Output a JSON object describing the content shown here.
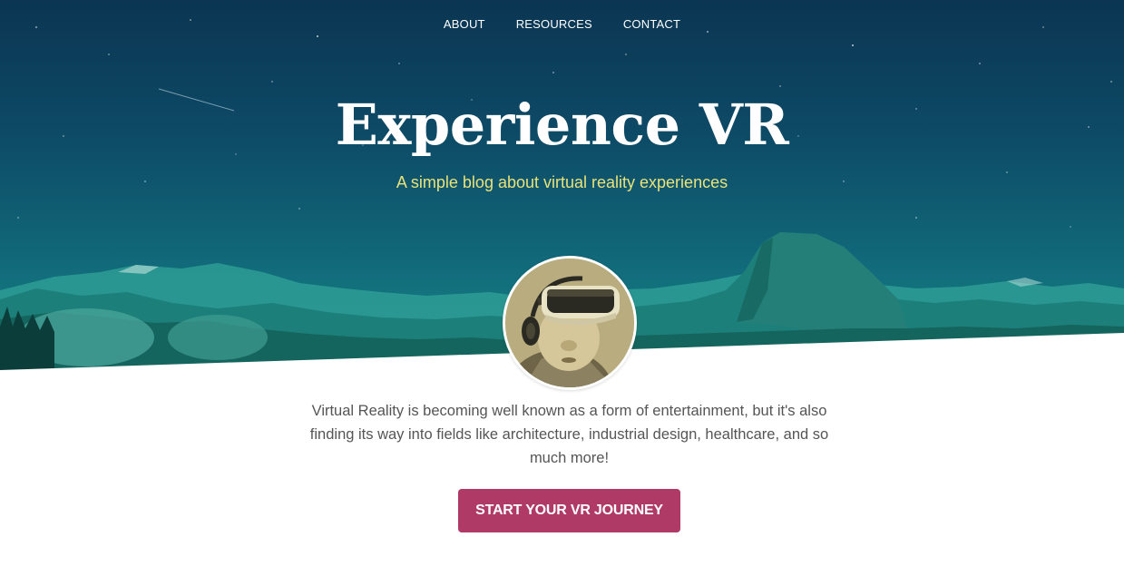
{
  "nav": {
    "items": [
      {
        "label": "ABOUT"
      },
      {
        "label": "RESOURCES"
      },
      {
        "label": "CONTACT"
      }
    ]
  },
  "hero": {
    "title": "Experience VR",
    "subtitle": "A simple blog about virtual reality experiences"
  },
  "intro": {
    "text": "Virtual Reality is becoming well known as a form of entertainment, but it's also finding its way into fields like architecture, industrial design, healthcare, and so much more!"
  },
  "cta": {
    "label": "START YOUR VR JOURNEY"
  },
  "colors": {
    "subtitle": "#e8e27a",
    "cta_background": "#b03a66",
    "sky_top": "#0b3552",
    "mountain": "#1f8d86"
  },
  "images": {
    "hero_background": "night-sky-mountains",
    "avatar": "person-wearing-vr-headset"
  }
}
